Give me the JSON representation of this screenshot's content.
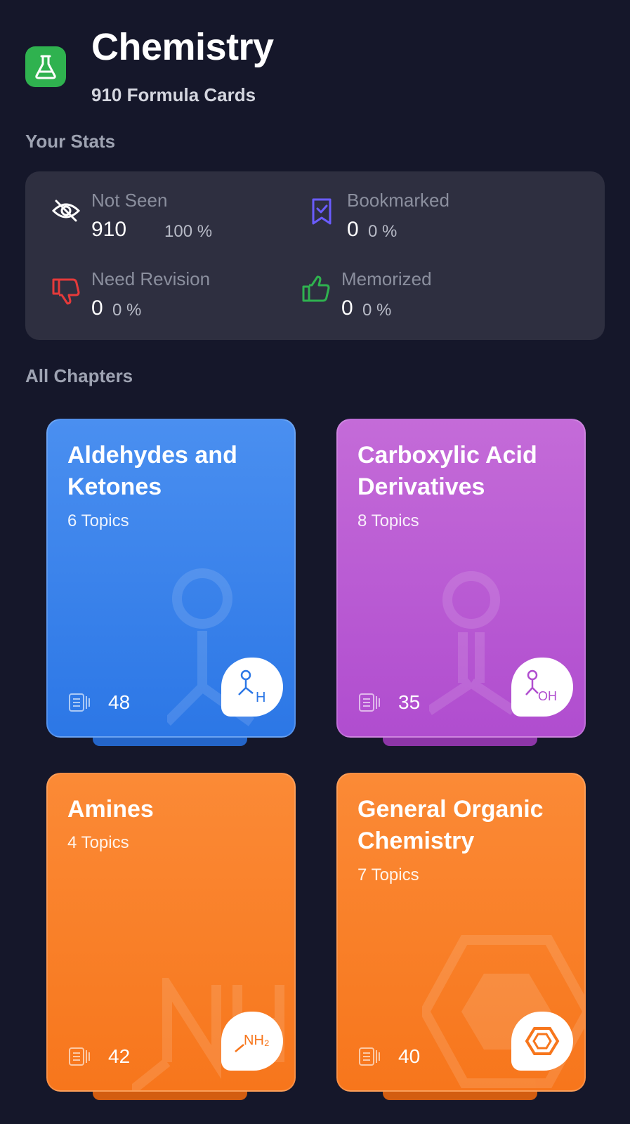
{
  "header": {
    "title": "Chemistry",
    "subtitle": "910 Formula Cards"
  },
  "stats": {
    "section_label": "Your Stats",
    "items": [
      {
        "label": "Not Seen",
        "count": "910",
        "percent": "100 %",
        "icon": "eye-off-icon"
      },
      {
        "label": "Bookmarked",
        "count": "0",
        "percent": "0 %",
        "icon": "bookmark-icon"
      },
      {
        "label": "Need Revision",
        "count": "0",
        "percent": "0 %",
        "icon": "thumbs-down-icon"
      },
      {
        "label": "Memorized",
        "count": "0",
        "percent": "0 %",
        "icon": "thumbs-up-icon"
      }
    ]
  },
  "chapters": {
    "section_label": "All Chapters",
    "items": [
      {
        "name": "Aldehydes and Ketones",
        "topics": "6 Topics",
        "cards": "48",
        "color": "#3b85ec",
        "badge_icon": "aldehyde-icon",
        "badge_text": "H"
      },
      {
        "name": "Carboxylic Acid Derivatives",
        "topics": "8 Topics",
        "cards": "35",
        "color": "#b75bd3",
        "badge_icon": "carboxylic-acid-icon",
        "badge_text": "OH"
      },
      {
        "name": "Amines",
        "topics": "4 Topics",
        "cards": "42",
        "color": "#f97f29",
        "badge_icon": "amine-icon",
        "badge_text": "NH₂"
      },
      {
        "name": "General Organic Chemistry",
        "topics": "7 Topics",
        "cards": "40",
        "color": "#f97f29",
        "badge_icon": "hexagon-ring-icon",
        "badge_text": ""
      }
    ]
  },
  "colors": {
    "background": "#15172a",
    "panel": "#2e2f40",
    "app_icon": "#2fb24f",
    "bookmark": "#6a5cff",
    "revision": "#e53a3a",
    "memorized": "#2fb24f"
  }
}
